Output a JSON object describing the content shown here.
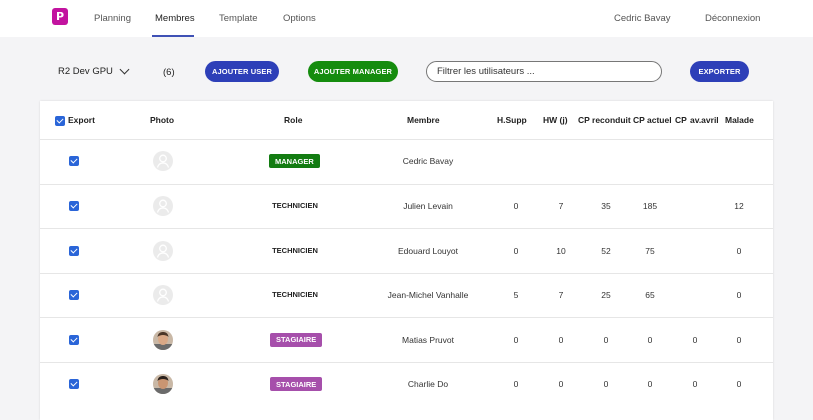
{
  "nav": {
    "logo_letter": "P",
    "links": [
      "Planning",
      "Membres",
      "Template",
      "Options"
    ],
    "user_name": "Cedric Bavay",
    "logout": "Déconnexion"
  },
  "toolbar": {
    "team": "R2 Dev GPU",
    "count": "(6)",
    "add_user": "AJOUTER USER",
    "add_manager": "AJOUTER MANAGER",
    "search_placeholder": "Filtrer les utilisateurs ...",
    "export": "EXPORTER"
  },
  "table": {
    "headers": [
      "Export",
      "Photo",
      "Role",
      "Membre",
      "H.Supp",
      "HW (j)",
      "CP reconduit",
      "CP actuel",
      "CP",
      "av.avril",
      "Malade"
    ],
    "rows": [
      {
        "role": "MANAGER",
        "member": "Cedric  Bavay",
        "values": [
          "",
          "",
          "",
          "",
          "",
          ""
        ]
      },
      {
        "role": "TECHNICIEN",
        "member": "Julien  Levain",
        "values": [
          "0",
          "7",
          "35",
          "185",
          "",
          "12"
        ]
      },
      {
        "role": "TECHNICIEN",
        "member": "Edouard  Louyot",
        "values": [
          "0",
          "10",
          "52",
          "75",
          "",
          "0"
        ]
      },
      {
        "role": "TECHNICIEN",
        "member": "Jean-Michel  Vanhalle",
        "values": [
          "5",
          "7",
          "25",
          "65",
          "",
          "0"
        ]
      },
      {
        "role": "STAGIAIRE",
        "member": "Matias  Pruvot",
        "values": [
          "0",
          "0",
          "0",
          "0",
          "0",
          "0"
        ]
      },
      {
        "role": "STAGIAIRE",
        "member": "Charlie  Do",
        "values": [
          "0",
          "0",
          "0",
          "0",
          "0",
          "0"
        ]
      }
    ]
  },
  "colors": {
    "brand": "#c2139f",
    "primary": "#2d3fb8",
    "success": "#158c0e",
    "manager_badge": "#137c12",
    "intern_badge": "#a64fab",
    "checkbox": "#2a65d8"
  }
}
